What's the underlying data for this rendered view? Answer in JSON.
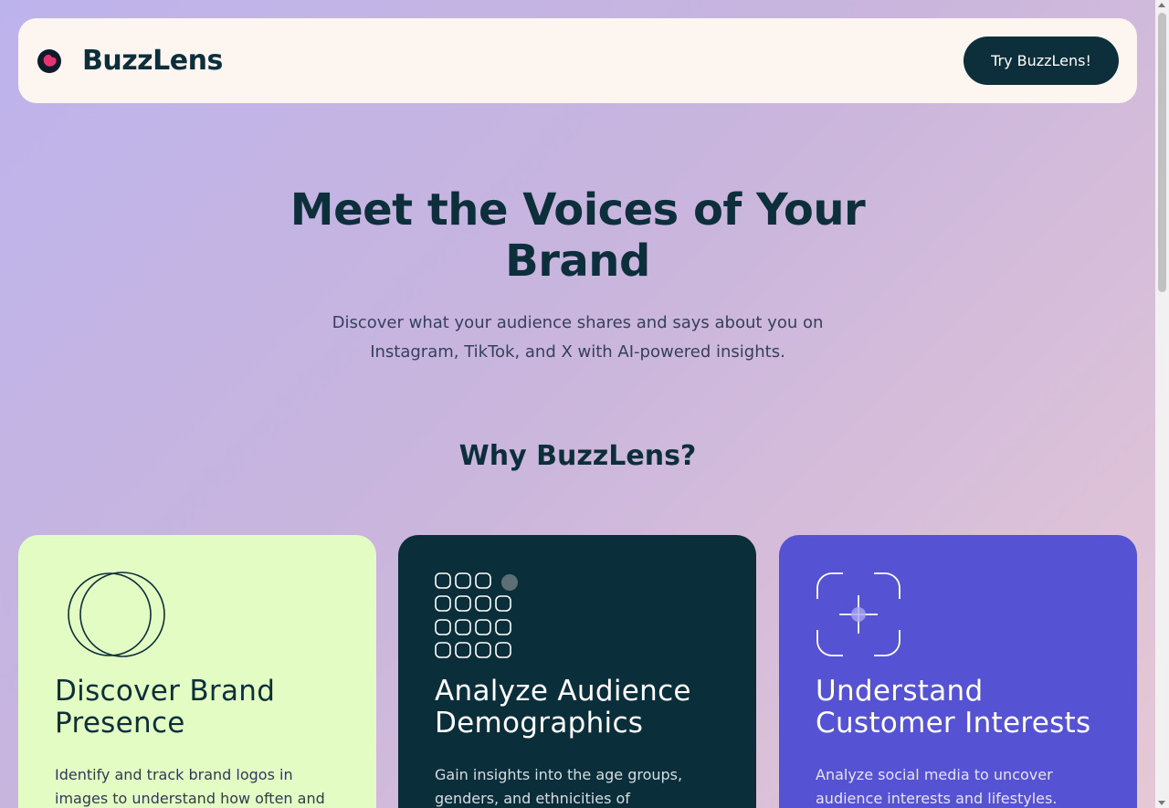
{
  "header": {
    "brand_name": "BuzzLens",
    "cta_label": "Try BuzzLens!"
  },
  "hero": {
    "title": "Meet the Voices of Your Brand",
    "subtitle": "Discover what your audience shares and says about you on Instagram, TikTok, and X with AI-powered insights."
  },
  "features": {
    "section_title": "Why BuzzLens?",
    "cards": [
      {
        "title": "Discover Brand Presence",
        "text": "Identify and track brand logos in images to understand how often and",
        "icon": "overlapping-circles-icon"
      },
      {
        "title": "Analyze Audience Demographics",
        "text": "Gain insights into the age groups, genders, and ethnicities of",
        "icon": "dot-grid-icon"
      },
      {
        "title": "Understand Customer Interests",
        "text": "Analyze social media to uncover audience interests and lifestyles.",
        "icon": "focus-frame-icon"
      }
    ]
  },
  "colors": {
    "brand_dark": "#0d2e3b",
    "header_bg": "#fdf5f0",
    "card_1_bg": "#e2fcc4",
    "card_2_bg": "#0b2f3a",
    "card_3_bg": "#5652d4",
    "logo_accent": "#e8336e"
  }
}
